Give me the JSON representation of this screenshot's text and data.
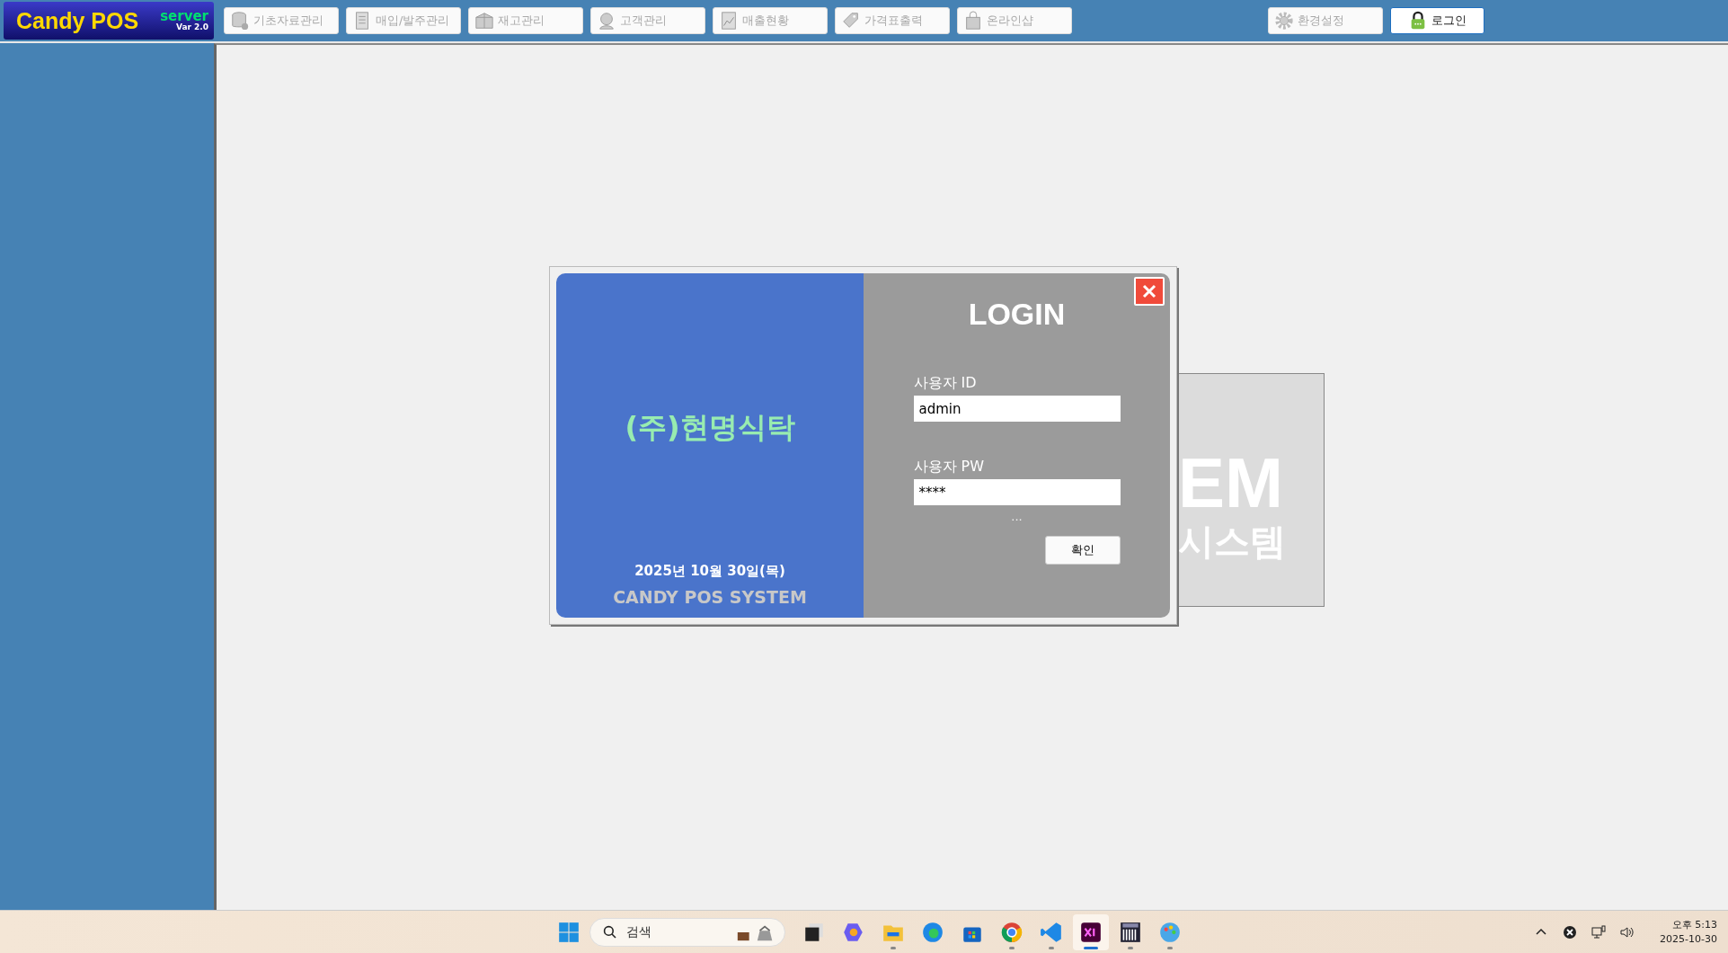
{
  "app": {
    "logo": "Candy POS",
    "edition": "server",
    "version": "Var 2.0"
  },
  "menu": [
    {
      "label": "기초자료관리",
      "disabled": true
    },
    {
      "label": "매입/발주관리",
      "disabled": true
    },
    {
      "label": "재고관리",
      "disabled": true
    },
    {
      "label": "고객관리",
      "disabled": true
    },
    {
      "label": "매출현황",
      "disabled": true
    },
    {
      "label": "가격표출력",
      "disabled": true
    },
    {
      "label": "온라인샵",
      "disabled": true
    }
  ],
  "right_menu": [
    {
      "label": "환경설정",
      "disabled": true
    },
    {
      "label": "로그인",
      "disabled": false
    }
  ],
  "background_panel": {
    "text_1": "EM",
    "text_2": "시스템"
  },
  "login_dialog": {
    "company": "(주)현명식탁",
    "date": "2025년 10월 30일(목)",
    "system_name": "CANDY POS SYSTEM",
    "title": "LOGIN",
    "fields": [
      {
        "label": "사용자 ID",
        "value": "admin"
      },
      {
        "label": "사용자 PW",
        "value": "****"
      }
    ],
    "status": "...",
    "confirm_button": "확인"
  },
  "taskbar": {
    "search_placeholder": "검색",
    "apps": [
      {
        "running": false,
        "active": false
      },
      {
        "running": false,
        "active": false
      },
      {
        "running": true,
        "active": false
      },
      {
        "running": false,
        "active": false
      },
      {
        "running": false,
        "active": false
      },
      {
        "running": true,
        "active": false
      },
      {
        "running": true,
        "active": false
      },
      {
        "running": true,
        "active": true
      },
      {
        "running": true,
        "active": false
      },
      {
        "running": true,
        "active": false
      }
    ],
    "clock": {
      "time": "오후 5:13",
      "date": "2025-10-30"
    }
  }
}
